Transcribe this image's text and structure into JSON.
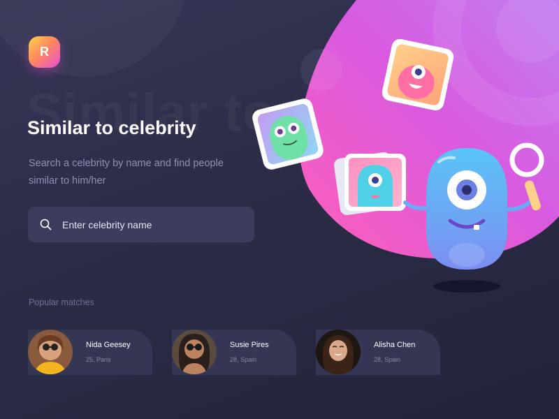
{
  "logo": {
    "letter": "R"
  },
  "hero": {
    "ghost_text": "Similar to",
    "title": "Similar to celebrity",
    "subtitle": "Search a celebrity by name and find people similar to him/her"
  },
  "search": {
    "placeholder": "Enter celebrity name",
    "value": "",
    "icon": "search-icon"
  },
  "popular": {
    "label": "Popular matches",
    "matches": [
      {
        "name": "Nida Geesey",
        "meta": "25, Paris"
      },
      {
        "name": "Susie Pires",
        "meta": "28, Spain"
      },
      {
        "name": "Alisha Chen",
        "meta": "28, Spain"
      }
    ]
  },
  "colors": {
    "background": "#2b2c47",
    "accent_pink": "#ff5fb8",
    "accent_purple": "#c25ae6",
    "card": "#353654",
    "input": "#3c3d5c",
    "mascot_blue": "#6ea9f7"
  }
}
